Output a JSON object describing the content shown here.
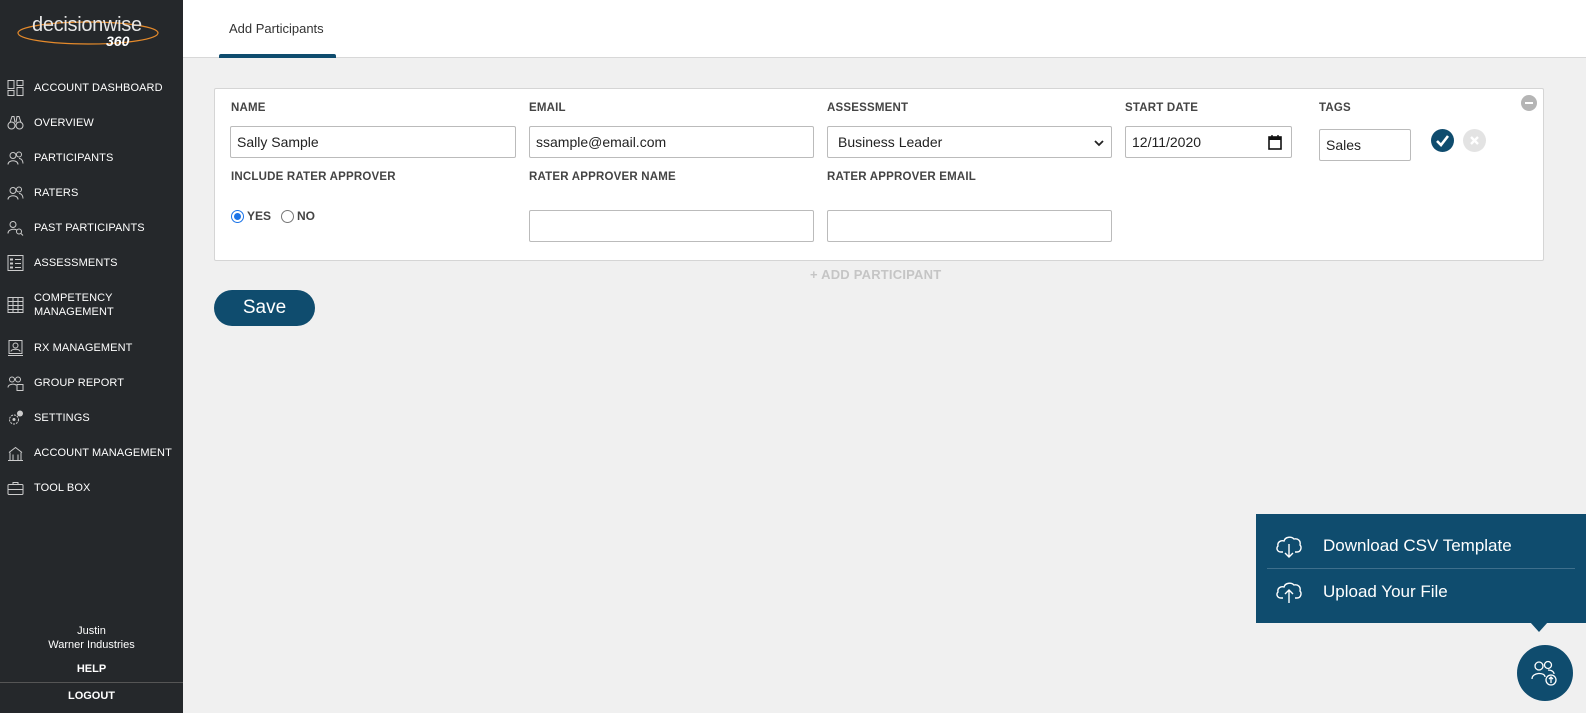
{
  "brand": {
    "name": "decisionwise",
    "suffix": "360"
  },
  "sidebar": {
    "items": [
      {
        "label": "ACCOUNT DASHBOARD",
        "icon": "dashboard-icon"
      },
      {
        "label": "OVERVIEW",
        "icon": "binoculars-icon"
      },
      {
        "label": "PARTICIPANTS",
        "icon": "people-icon"
      },
      {
        "label": "RATERS",
        "icon": "people-icon"
      },
      {
        "label": "PAST PARTICIPANTS",
        "icon": "people-search-icon"
      },
      {
        "label": "ASSESSMENTS",
        "icon": "checklist-icon"
      },
      {
        "label": "COMPETENCY",
        "label2": "MANAGEMENT",
        "icon": "grid-icon"
      },
      {
        "label": "RX MANAGEMENT",
        "icon": "id-card-icon"
      },
      {
        "label": "GROUP REPORT",
        "icon": "group-report-icon"
      },
      {
        "label": "SETTINGS",
        "icon": "gear-icon"
      },
      {
        "label": "ACCOUNT MANAGEMENT",
        "icon": "building-icon"
      },
      {
        "label": "TOOL BOX",
        "icon": "toolbox-icon"
      }
    ],
    "user_name": "Justin",
    "company": "Warner Industries",
    "help": "HELP",
    "logout": "LOGOUT"
  },
  "header": {
    "tab": "Add Participants"
  },
  "form": {
    "labels": {
      "name": "NAME",
      "email": "EMAIL",
      "assessment": "ASSESSMENT",
      "start_date": "START DATE",
      "tags": "TAGS",
      "include_rater_approver": "INCLUDE RATER APPROVER",
      "rater_approver_name": "RATER APPROVER NAME",
      "rater_approver_email": "RATER APPROVER EMAIL"
    },
    "values": {
      "name": "Sally Sample",
      "email": "ssample@email.com",
      "assessment": "Business Leader",
      "start_date": "12/11/2020",
      "tags": "Sales",
      "rater_approver_name": "",
      "rater_approver_email": ""
    },
    "radio": {
      "yes": "YES",
      "no": "NO",
      "selected": "YES"
    },
    "add_participant": "+ ADD PARTICIPANT",
    "save": "Save"
  },
  "popover": {
    "download": "Download CSV Template",
    "upload": "Upload Your File"
  },
  "colors": {
    "primary": "#0f4c6e",
    "sidebar": "#25282b",
    "background": "#f0f0f0"
  }
}
